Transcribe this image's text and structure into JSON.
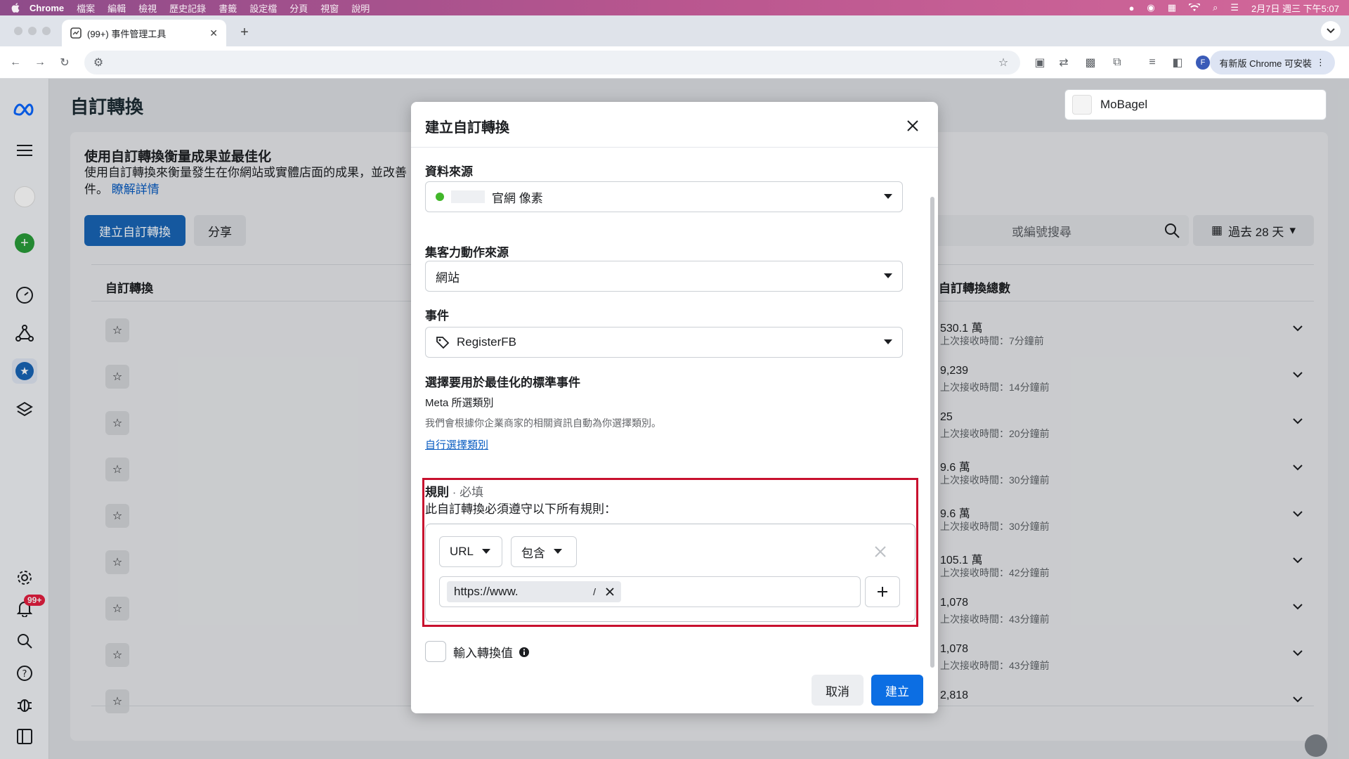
{
  "menubar": {
    "apple": "",
    "app": "Chrome",
    "items": [
      "檔案",
      "編輯",
      "檢視",
      "歷史記錄",
      "書籤",
      "設定檔",
      "分頁",
      "視窗",
      "說明"
    ],
    "clock": "2月7日 週三 下午5:07"
  },
  "browser": {
    "tab_title": "(99+) 事件管理工具",
    "new_tab": "+",
    "update_label": "有新版 Chrome 可安裝",
    "profile_initial": "F"
  },
  "page": {
    "title": "自訂轉換",
    "account_name": "MoBagel",
    "card_heading": "使用自訂轉換衡量成果並最佳化",
    "card_desc": "使用自訂轉換來衡量發生在你網站或實體店面的成果，並改善",
    "card_desc2": "件。",
    "learn_more": "瞭解詳情",
    "create_button": "建立自訂轉換",
    "share_button": "分享",
    "search_placeholder": "或編號搜尋",
    "date_range": "過去 28 天",
    "col_left": "自訂轉換",
    "col_right": "自訂轉換總數",
    "rows": [
      {
        "value": "530.1 萬",
        "sub": "上次接收時間：7分鐘前"
      },
      {
        "value": "9,239",
        "sub": "上次接收時間：14分鐘前"
      },
      {
        "value": "25",
        "sub": "上次接收時間：20分鐘前"
      },
      {
        "value": "9.6 萬",
        "sub": "上次接收時間：30分鐘前"
      },
      {
        "value": "9.6 萬",
        "sub": "上次接收時間：30分鐘前"
      },
      {
        "value": "105.1 萬",
        "sub": "上次接收時間：42分鐘前"
      },
      {
        "value": "1,078",
        "sub": "上次接收時間：43分鐘前"
      },
      {
        "value": "1,078",
        "sub": "上次接收時間：43分鐘前"
      },
      {
        "value": "2,818",
        "sub": ""
      }
    ],
    "notification_badge": "99+"
  },
  "dialog": {
    "title": "建立自訂轉換",
    "data_source_label": "資料來源",
    "data_source_value": "官網 像素",
    "action_source_label": "集客力動作來源",
    "action_source_value": "網站",
    "event_label": "事件",
    "event_value": "RegisterFB",
    "std_event_label": "選擇要用於最佳化的標準事件",
    "meta_category": "Meta 所選類別",
    "meta_category_desc": "我們會根據你企業商家的相關資訊自動為你選擇類別。",
    "choose_category_link": "自行選擇類別",
    "rules_label": "規則",
    "rules_required": "· 必填",
    "rules_desc": "此自訂轉換必須遵守以下所有規則：",
    "rule_field": "URL",
    "rule_operator": "包含",
    "rule_value": "https://www.",
    "rule_value_suffix": "/",
    "conversion_value_label": "輸入轉換值",
    "cancel": "取消",
    "create": "建立"
  },
  "colors": {
    "primary": "#0c6ee3",
    "highlight_border": "#c8102e",
    "status_green": "#42b72a",
    "badge_red": "#e41e3f"
  }
}
